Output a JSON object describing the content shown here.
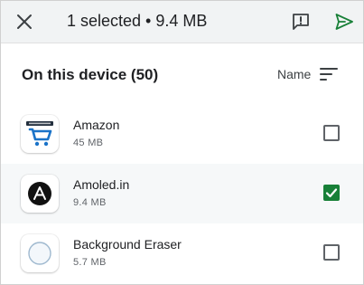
{
  "appbar": {
    "title": "1 selected • 9.4 MB",
    "close_icon": "close-icon",
    "feedback_icon": "feedback-icon",
    "send_icon": "send-icon"
  },
  "section": {
    "title": "On this device (50)",
    "sort_label": "Name",
    "sort_icon": "sort-icon"
  },
  "apps": [
    {
      "name": "Amazon",
      "size": "45 MB",
      "selected": false,
      "icon": "amazon-app-icon"
    },
    {
      "name": "Amoled.in",
      "size": "9.4 MB",
      "selected": true,
      "icon": "amoled-app-icon"
    },
    {
      "name": "Background Eraser",
      "size": "5.7 MB",
      "selected": false,
      "icon": "background-eraser-app-icon"
    }
  ],
  "colors": {
    "appbar_bg": "#f1f3f4",
    "accent_green": "#188038",
    "text_primary": "#202124",
    "text_secondary": "#5f6368"
  }
}
